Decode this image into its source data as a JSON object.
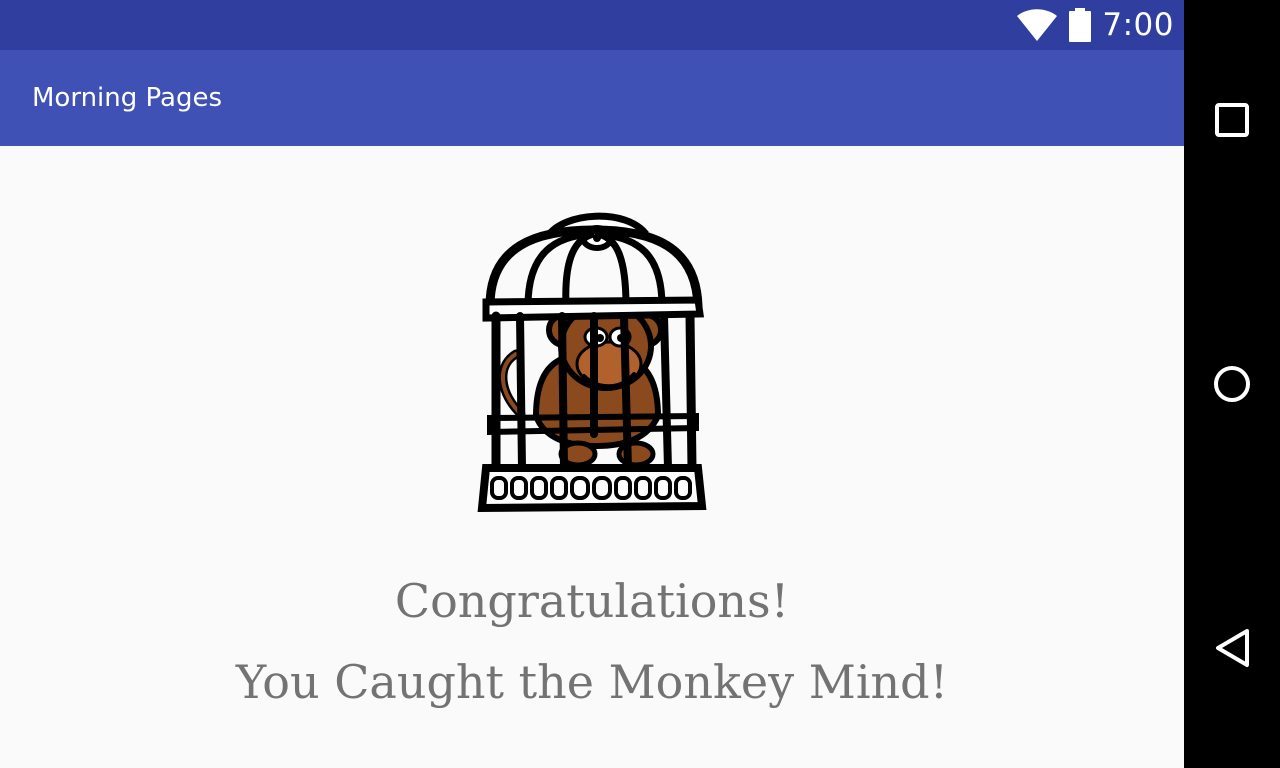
{
  "status_bar": {
    "time": "7:00",
    "icons": [
      "wifi-icon",
      "battery-icon"
    ]
  },
  "app_bar": {
    "title": "Morning Pages"
  },
  "main": {
    "image_icon": "monkey-in-cage",
    "congrats": "Congratulations!",
    "message": "You Caught the Monkey Mind!"
  },
  "nav_bar": {
    "buttons": [
      "recent-apps-icon",
      "home-icon",
      "back-icon"
    ]
  },
  "colors": {
    "status_bar": "#303f9f",
    "app_bar": "#3f51b5",
    "background": "#fafafa",
    "text": "#737373",
    "monkey": "#8b4a1e"
  }
}
